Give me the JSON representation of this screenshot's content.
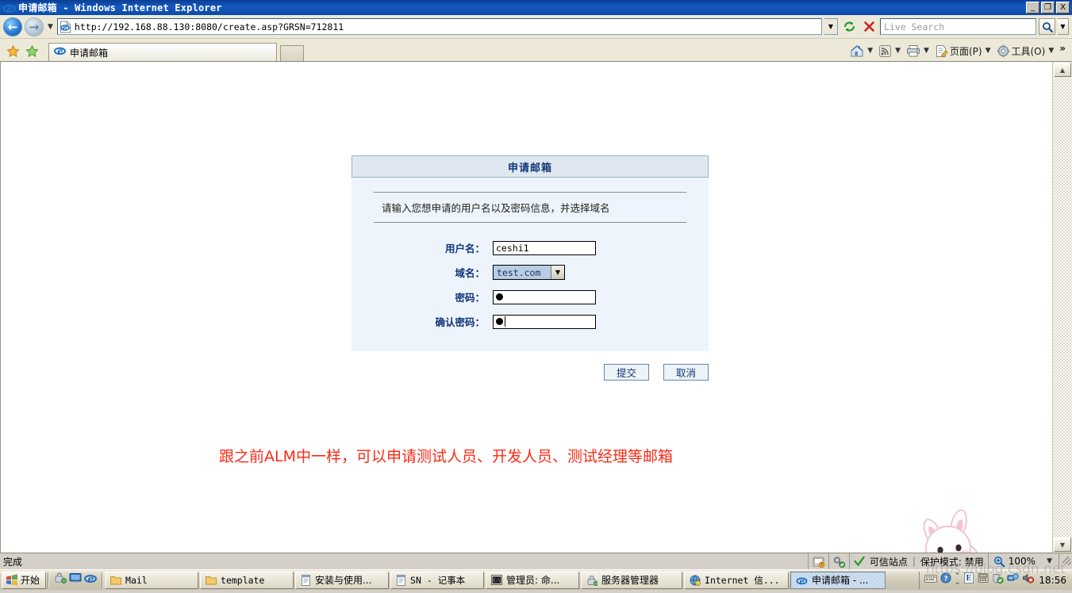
{
  "window": {
    "title": "申请邮箱 - Windows Internet Explorer",
    "minimize_label": "_",
    "maximize_label": "❐",
    "close_label": "X"
  },
  "navigation": {
    "back_icon": "back-arrow-icon",
    "forward_icon": "forward-arrow-icon",
    "history_dropdown_icon": "chevron-down-icon",
    "url": "http://192.168.88.130:8080/create.asp?GRSN=712811",
    "url_dropdown_icon": "chevron-down-icon",
    "refresh_icon": "refresh-icon",
    "stop_icon": "stop-icon",
    "search_placeholder": "Live Search",
    "search_go_icon": "magnifier-icon",
    "search_dropdown_icon": "chevron-down-icon"
  },
  "tabs": {
    "favorites_icon": "star-icon",
    "add_favorite_icon": "add-star-icon",
    "items": [
      {
        "label": "申请邮箱",
        "icon": "ie-icon",
        "active": true
      }
    ],
    "new_tab_label": ""
  },
  "command_bar": {
    "home_label": "",
    "feeds_label": "",
    "print_label": "",
    "page_label": "页面(P)",
    "tools_label": "工具(O)",
    "overflow_label": "»"
  },
  "page": {
    "panel_title": "申请邮箱",
    "intro": "请输入您想申请的用户名以及密码信息，并选择域名",
    "fields": [
      {
        "label": "用户名：",
        "type": "text",
        "value": "ceshi1",
        "name": "username"
      },
      {
        "label": "域名：",
        "type": "select",
        "value": "test.com",
        "name": "domain"
      },
      {
        "label": "密码：",
        "type": "password",
        "value": "●",
        "name": "password"
      },
      {
        "label": "确认密码：",
        "type": "password",
        "value": "●",
        "name": "confirm-password"
      }
    ],
    "submit_label": "提交",
    "cancel_label": "取消",
    "annotation": "跟之前ALM中一样，可以申请测试人员、开发人员、测试经理等邮箱",
    "annotation_color": "#fb2a15",
    "header_bg": "#dfe8f0",
    "body_bg": "#eef4fb",
    "label_color": "#11357a",
    "mascot_icon": "rabbit-with-piggybanks-image"
  },
  "status_bar": {
    "message": "完成",
    "security_icon": "internet-zone-icon",
    "privacy_icon": "privacy-key-icon",
    "check_icon": "green-check-icon",
    "zone_text": "可信站点",
    "separator": "|",
    "protected_mode": "保护模式: 禁用",
    "zoom_icon": "zoom-magnifier-icon",
    "zoom_level": "100%",
    "zoom_dropdown_icon": "chevron-down-icon"
  },
  "taskbar": {
    "start_label": "开始",
    "start_icon": "windows-flag-icon",
    "quick_launch": [
      {
        "icon": "show-desktop-lock-icon",
        "name": "show-desktop"
      },
      {
        "icon": "monitor-icon",
        "name": "display"
      },
      {
        "icon": "ie-icon",
        "name": "internet-explorer"
      }
    ],
    "items": [
      {
        "label": "Mail",
        "icon": "folder-icon",
        "active": false
      },
      {
        "label": "template",
        "icon": "folder-icon",
        "active": false
      },
      {
        "label": "安装与使用...",
        "icon": "notepad-icon",
        "active": false
      },
      {
        "label": "SN - 记事本",
        "icon": "notepad-icon",
        "active": false
      },
      {
        "label": "管理员: 命...",
        "icon": "cmd-icon",
        "active": false
      },
      {
        "label": "服务器管理器",
        "icon": "server-manager-icon",
        "active": false
      },
      {
        "label": "Internet 信...",
        "icon": "iis-icon",
        "active": false
      },
      {
        "label": "申请邮箱 - ...",
        "icon": "ie-icon",
        "active": true
      }
    ],
    "tray": [
      {
        "icon": "keyboard-ime-icon",
        "name": "ime-keyboard"
      },
      {
        "icon": "help-circle-icon",
        "name": "ime-help"
      },
      {
        "icon": "ime-toggle-icon",
        "name": "ime-toggle"
      },
      {
        "icon": "editor-icon",
        "name": "tray-editor"
      },
      {
        "icon": "calculator-icon",
        "name": "tray-calculator"
      },
      {
        "icon": "shield-check-icon",
        "name": "tray-security"
      },
      {
        "icon": "network-icon",
        "name": "tray-network"
      },
      {
        "icon": "volume-muted-icon",
        "name": "tray-volume"
      }
    ],
    "clock": "18:56"
  },
  "watermark": "https://blog.csdn.net"
}
